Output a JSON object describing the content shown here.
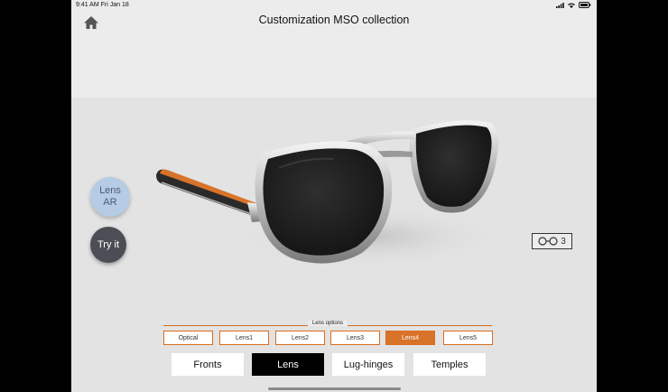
{
  "status": {
    "time": "9:41 AM Fri Jan 18"
  },
  "header": {
    "title": "Customization MSO collection",
    "home_icon": "home-icon"
  },
  "side_buttons": {
    "lens_ar_line1": "Lens",
    "lens_ar_line2": "AR",
    "try_it": "Try it"
  },
  "compare": {
    "count": "3",
    "icon": "glasses-icon"
  },
  "lens_options": {
    "label": "Lens options",
    "items": [
      "Optical",
      "Lens1",
      "Lens2",
      "Lens3",
      "Lens4",
      "Lens5"
    ],
    "selected": "Lens4"
  },
  "tabs": {
    "items": [
      "Fronts",
      "Lens",
      "Lug-hinges",
      "Temples"
    ],
    "selected": "Lens"
  },
  "colors": {
    "accent": "#d8732a",
    "lens_ar_bg": "#b6cbe4",
    "try_it_bg": "#4b4f55"
  }
}
